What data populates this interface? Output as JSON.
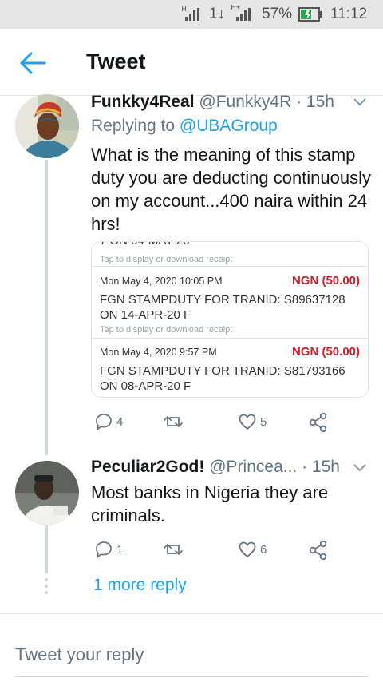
{
  "status_bar": {
    "signal_1": "ᴴ",
    "signal_2": "1↓",
    "signal_3": "ᴴ⁺",
    "battery": "57%",
    "time": "11:12"
  },
  "header": {
    "title": "Tweet"
  },
  "tweet": {
    "name": "Funkky4Real",
    "handle": "@Funkky4R",
    "time": "· 15h",
    "replying_prefix": "Replying to",
    "replying_to": "@UBAGroup",
    "text": "What is the meaning of this stamp duty you are deducting continuously on my account...400 naira within 24 hrs!",
    "receipt": {
      "cut_text": "7 ON 04-MAY-20",
      "tap_text": "Tap to display or download receipt",
      "transactions": [
        {
          "date": "Mon May 4, 2020 10:05 PM",
          "amount": "NGN (50.00)",
          "description": "FGN STAMPDUTY FOR TRANID: S89637128 ON 14-APR-20 F"
        },
        {
          "date": "Mon May 4, 2020 9:57 PM",
          "amount": "NGN (50.00)",
          "description": "FGN STAMPDUTY FOR TRANID: S81793166 ON 08-APR-20 F"
        }
      ]
    },
    "reply_count": "4",
    "retweet_count": "",
    "like_count": "5"
  },
  "reply": {
    "name": "Peculiar2God!",
    "handle": "@Princea...",
    "time": "· 15h",
    "text": "Most banks in Nigeria they are criminals.",
    "reply_count": "1",
    "retweet_count": "",
    "like_count": "6"
  },
  "more_replies": "1 more reply",
  "compose": {
    "placeholder": "Tweet your reply"
  },
  "colors": {
    "accent": "#1da1f2",
    "secondary_text": "#657786",
    "amount_red": "#cf1f2b"
  },
  "icons": {
    "back": "arrow-left-icon",
    "caret": "chevron-down-icon",
    "reply": "comment-icon",
    "retweet": "retweet-icon",
    "like": "heart-icon",
    "share": "share-icon"
  }
}
